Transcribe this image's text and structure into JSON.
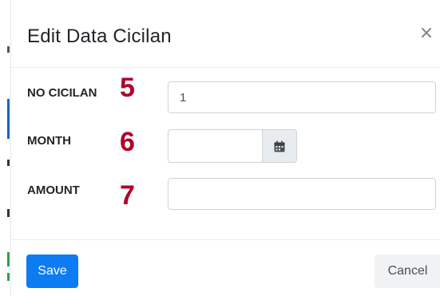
{
  "modal": {
    "title": "Edit Data Cicilan",
    "close_label": "×"
  },
  "form": {
    "fields": [
      {
        "label": "NO CICILAN",
        "step": "5",
        "value": "1"
      },
      {
        "label": "MONTH",
        "step": "6",
        "value": ""
      },
      {
        "label": "AMOUNT",
        "step": "7",
        "value": ""
      }
    ]
  },
  "footer": {
    "save_label": "Save",
    "cancel_label": "Cancel"
  },
  "icons": {
    "calendar": "calendar-icon",
    "close": "close-icon"
  },
  "colors": {
    "primary": "#0d7cf2",
    "step_number": "#b0002a",
    "addon_bg": "#e9ecef"
  }
}
